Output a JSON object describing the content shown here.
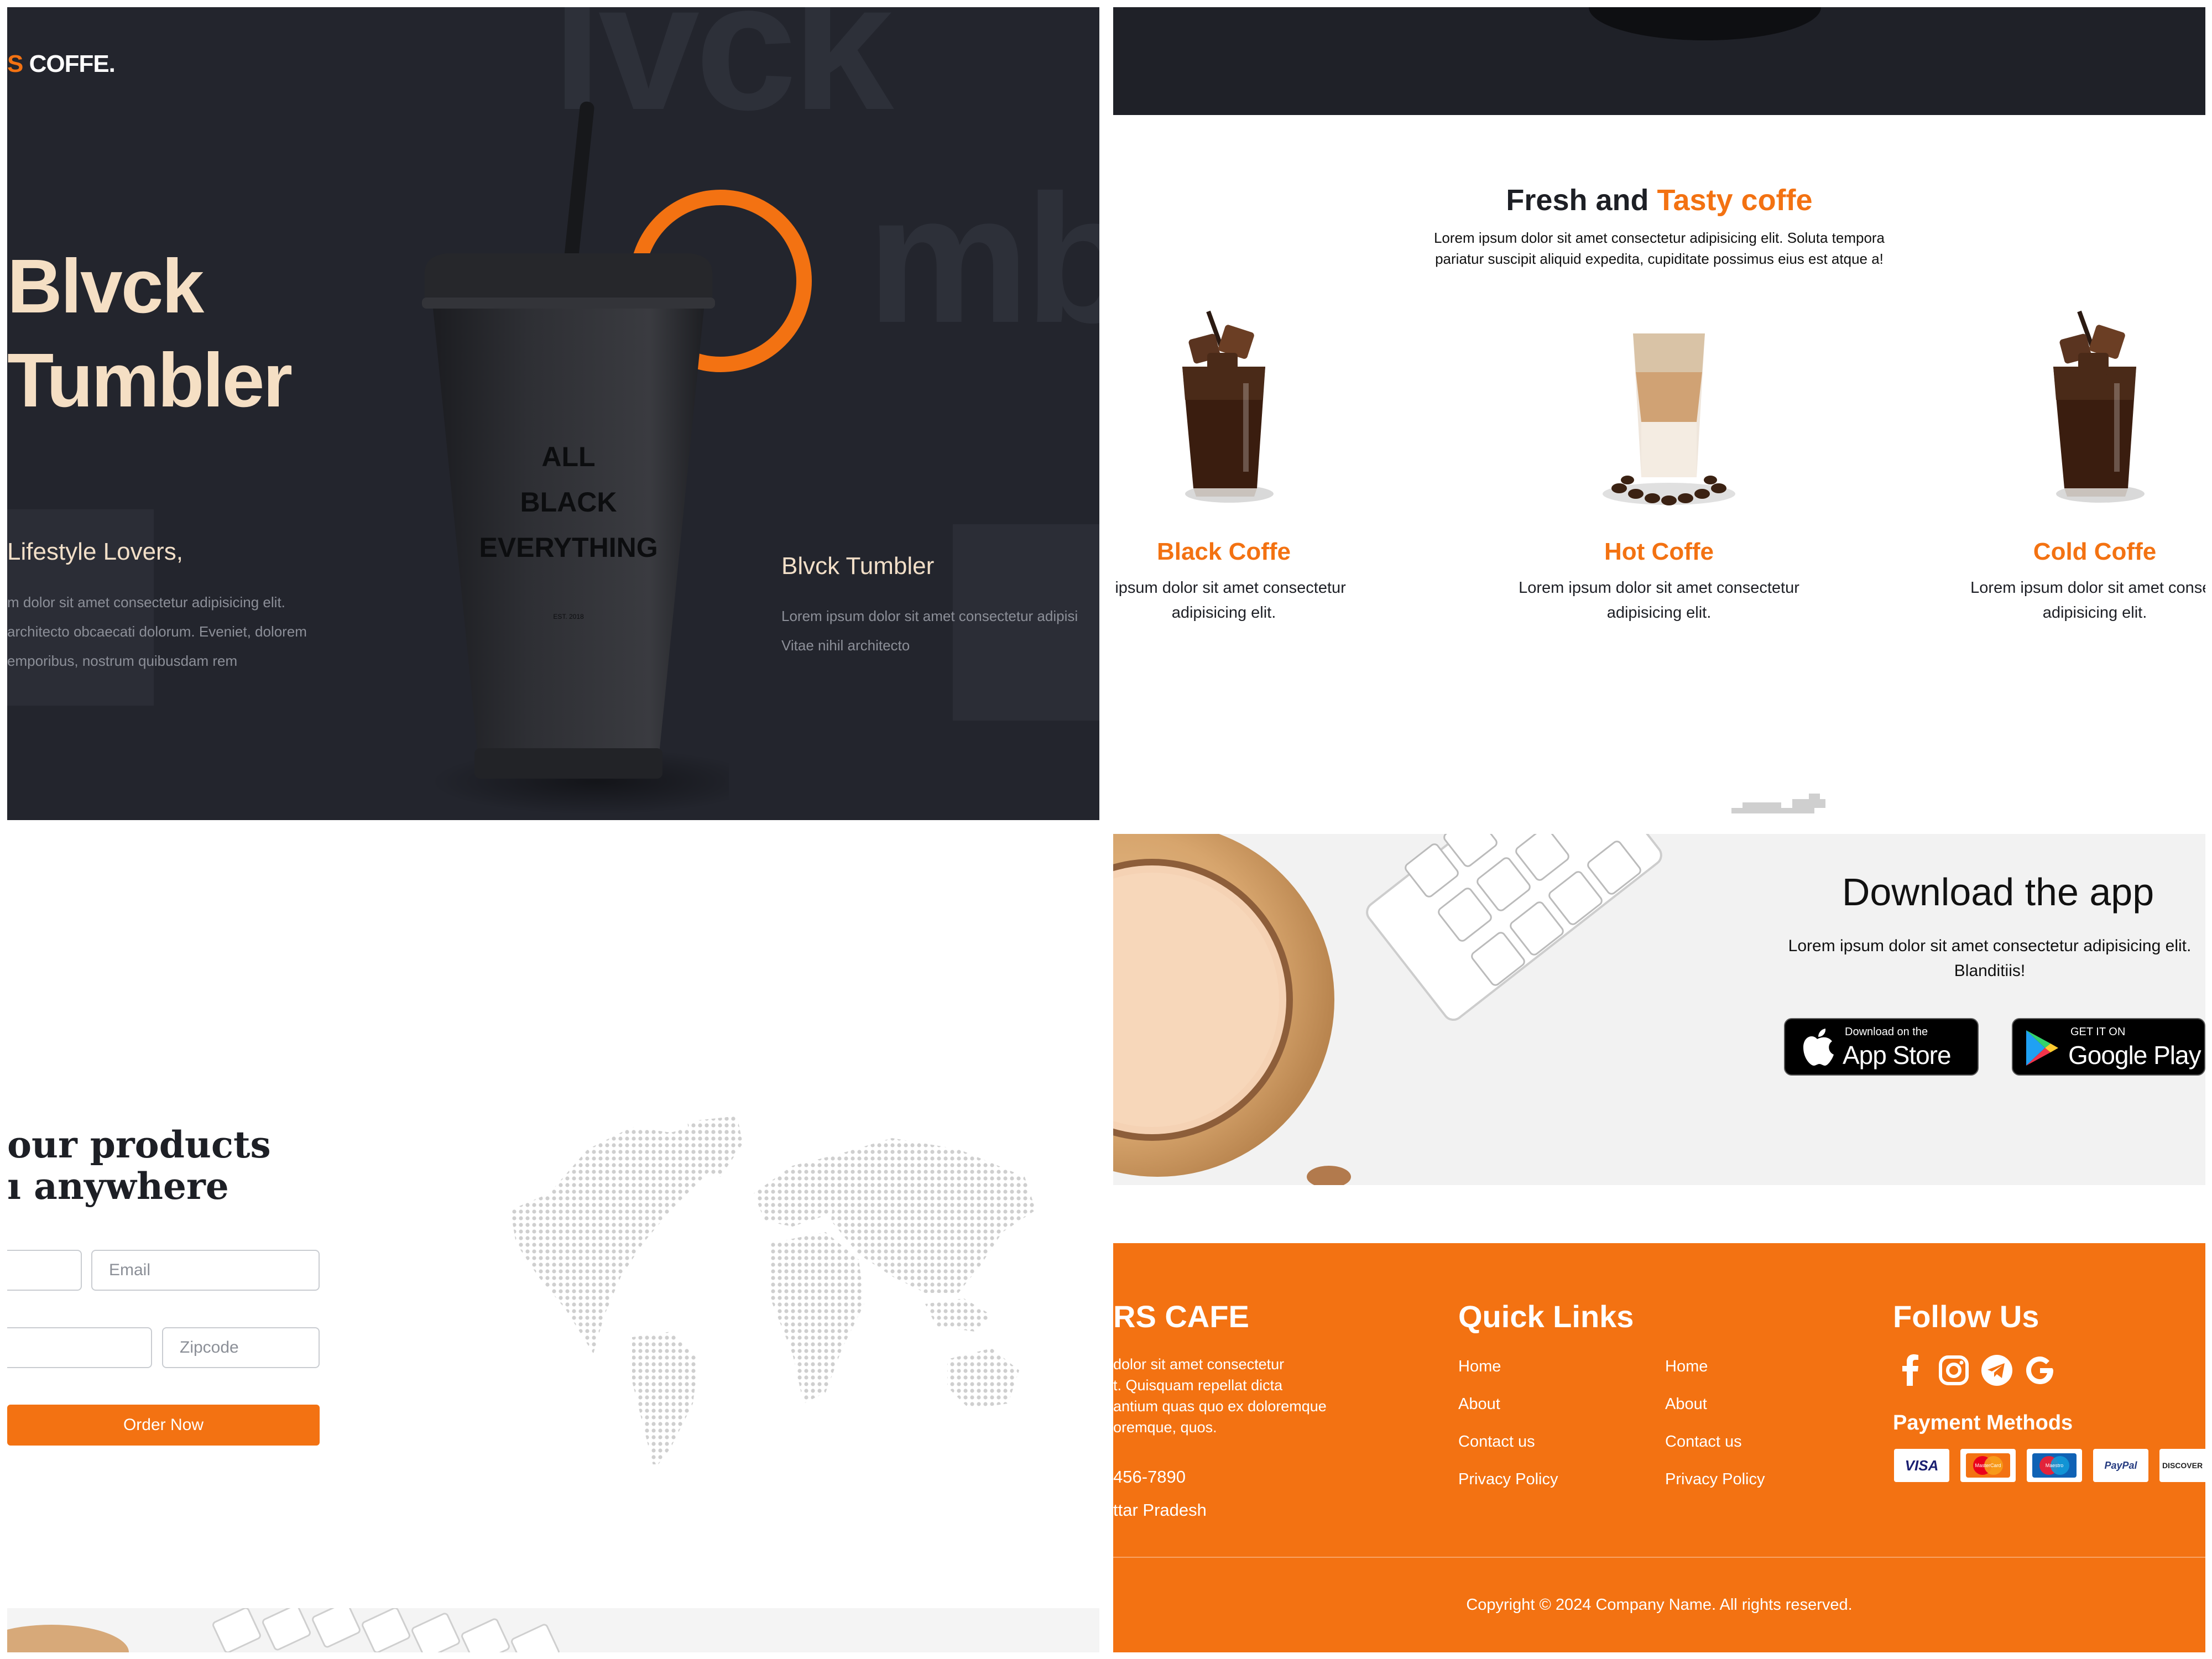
{
  "hero": {
    "logo_prefix": "S",
    "logo_main": " COFFE.",
    "watermark_top": "lvck",
    "watermark_mid": "mbl",
    "title_line1": "Blvck",
    "title_line2": "Tumbler",
    "cup_text_1": "ALL",
    "cup_text_2": "BLACK",
    "cup_text_3": "EVERYTHING",
    "cup_est": "EST. 2018",
    "left_heading": "Lifestyle Lovers,",
    "left_text_1": "m dolor sit amet consectetur adipisicing elit.",
    "left_text_2": "architecto obcaecati dolorum. Eveniet, dolorem",
    "left_text_3": "emporibus, nostrum quibusdam rem",
    "right_heading": "Blvck Tumbler",
    "right_text_1": "Lorem ipsum dolor sit amet consectetur adipisi",
    "right_text_2": "Vitae nihil architecto"
  },
  "fresh": {
    "title_plain": "Fresh and ",
    "title_accent": "Tasty coffe",
    "desc_1": "Lorem ipsum dolor sit amet consectetur adipisicing elit. Soluta tempora",
    "desc_2": "pariatur suscipit aliquid expedita, cupiditate possimus eius est atque a!",
    "items": [
      {
        "name": "Black Coffe",
        "desc_1": "n ipsum dolor sit amet consectetur",
        "desc_2": "adipisicing elit."
      },
      {
        "name": "Hot Coffe",
        "desc_1": "Lorem ipsum dolor sit amet consectetur",
        "desc_2": "adipisicing elit."
      },
      {
        "name": "Cold Coffe",
        "desc_1": "Lorem ipsum dolor sit amet consec",
        "desc_2": "adipisicing elit."
      }
    ]
  },
  "order": {
    "heading_1": "our products",
    "heading_2": "anywhere",
    "heading_2_prefix": "ı",
    "email_placeholder": "Email",
    "zipcode_placeholder": "Zipcode",
    "button_label": "Order Now"
  },
  "app": {
    "title": "Download the app",
    "desc_1": "Lorem ipsum dolor sit amet consectetur adipisicing elit.",
    "desc_2": "Blanditiis!",
    "appstore_small": "Download on the",
    "appstore_big": "App Store",
    "googleplay_small": "GET IT ON",
    "googleplay_big": "Google Play"
  },
  "footer": {
    "brand": "RS CAFE",
    "about_1": "dolor sit amet consectetur",
    "about_2": "t. Quisquam repellat dicta",
    "about_3": "antium quas quo ex doloremque",
    "about_4": "oremque, quos.",
    "phone": "456-7890",
    "location": "ttar Pradesh",
    "quick_links_title": "Quick Links",
    "links_col1": [
      "Home",
      "About",
      "Contact us",
      "Privacy Policy"
    ],
    "links_col2": [
      "Home",
      "About",
      "Contact us",
      "Privacy Policy"
    ],
    "follow_title": "Follow Us",
    "social_icons": [
      "facebook-icon",
      "instagram-icon",
      "telegram-icon",
      "google-icon"
    ],
    "payment_title": "Payment Methods",
    "payment_labels": [
      "VISA",
      "MasterCard",
      "Maestro",
      "PayPal",
      "DISCOVER"
    ],
    "copyright": "Copyright © 2024 Company Name. All rights reserved."
  },
  "colors": {
    "accent": "#f37212",
    "hero_bg": "#23252d",
    "cream": "#f5dfc4"
  }
}
